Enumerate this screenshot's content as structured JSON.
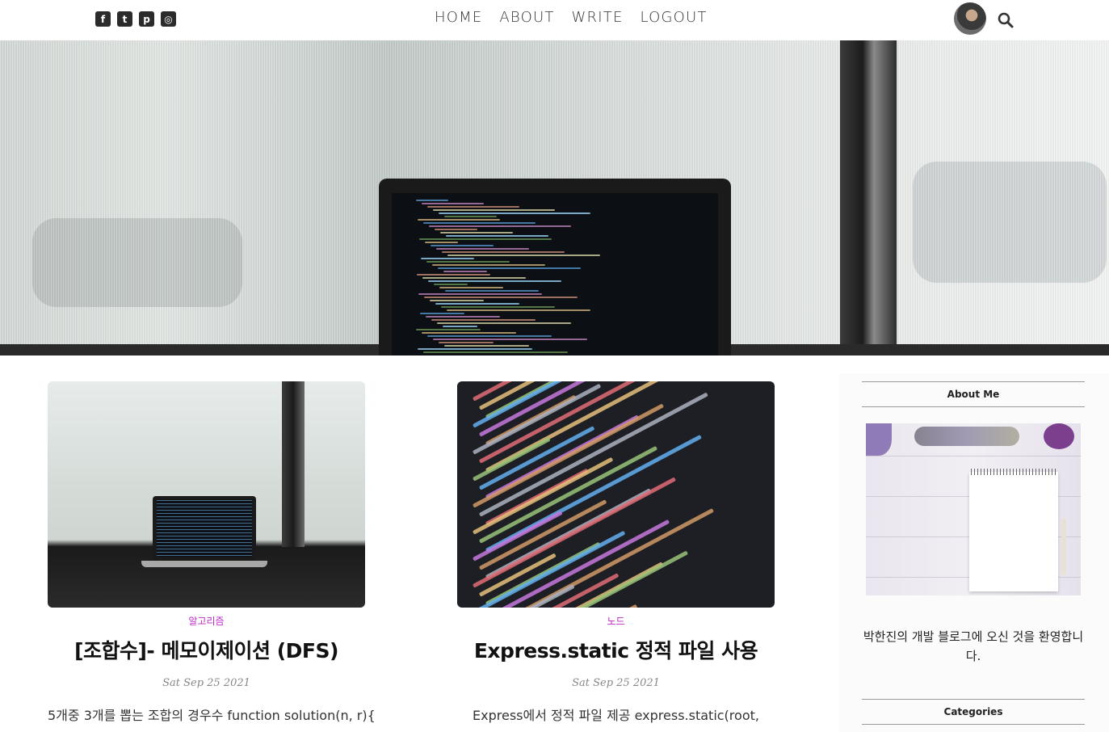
{
  "nav": {
    "social": [
      {
        "name": "facebook-icon",
        "glyph": "f"
      },
      {
        "name": "twitter-icon",
        "glyph": "t"
      },
      {
        "name": "pinterest-icon",
        "glyph": "p"
      },
      {
        "name": "instagram-icon",
        "glyph": "◎"
      }
    ],
    "links": [
      "HOME",
      "ABOUT",
      "WRITE",
      "LOGOUT"
    ]
  },
  "posts": [
    {
      "category": "알고리즘",
      "title": "[조합수]- 메모이제이션 (DFS)",
      "date": "Sat Sep 25 2021",
      "excerpt": "5개중 3개를 뽑는 조합의 경우수 function solution(n, r){"
    },
    {
      "category": "노드",
      "title": "Express.static 정적 파일 사용",
      "date": "Sat Sep 25 2021",
      "excerpt": "Express에서 정적 파일 제공 express.static(root,"
    }
  ],
  "sidebar": {
    "about_title": "About Me",
    "about_text": "박한진의 개발 블로그에 오신 것을 환영합니다.",
    "categories_title": "Categories"
  },
  "colors": {
    "category_accent": "#c026c8",
    "date_gray": "#888888"
  }
}
